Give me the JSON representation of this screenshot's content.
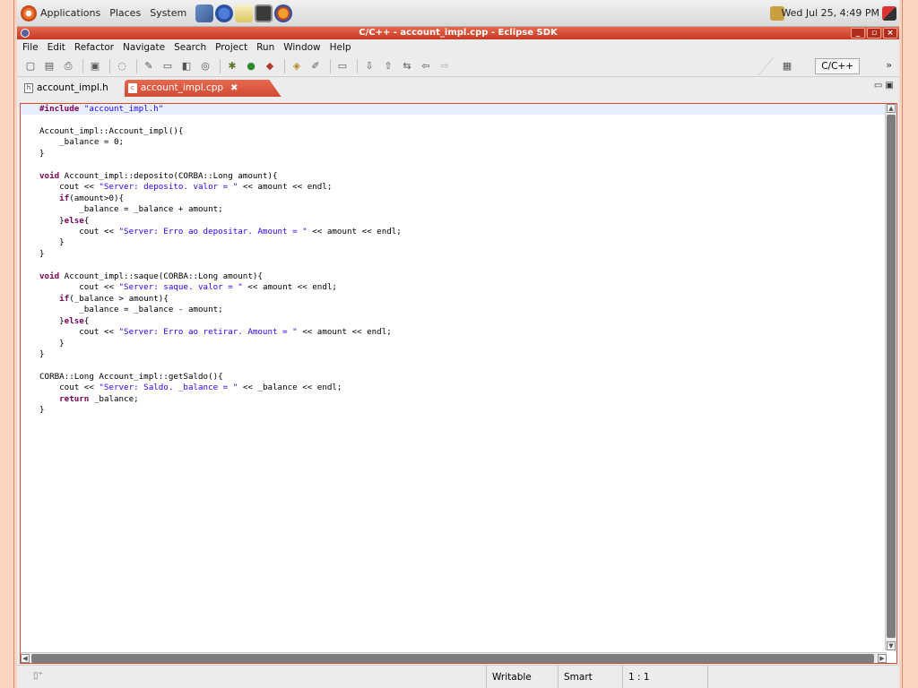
{
  "panel": {
    "menus": [
      "Applications",
      "Places",
      "System"
    ],
    "clock": "Wed Jul 25,  4:49 PM"
  },
  "window": {
    "title": "C/C++ - account_impl.cpp - Eclipse SDK",
    "controls": [
      "_",
      "▫",
      "×"
    ]
  },
  "menubar": [
    "File",
    "Edit",
    "Refactor",
    "Navigate",
    "Search",
    "Project",
    "Run",
    "Window",
    "Help"
  ],
  "toolbar": {
    "perspective": "C/C++",
    "more": "»"
  },
  "tabs": [
    {
      "label": "account_impl.h",
      "active": false
    },
    {
      "label": "account_impl.cpp",
      "active": true
    }
  ],
  "editor": {
    "lines": [
      "#include \"account_impl.h\"",
      "",
      "Account_impl::Account_impl(){",
      "    _balance = 0;",
      "}",
      "",
      "void Account_impl::deposito(CORBA::Long amount){",
      "    cout << \"Server: deposito. valor = \" << amount << endl;",
      "    if(amount>0){",
      "        _balance = _balance + amount;",
      "    }else{",
      "        cout << \"Server: Erro ao depositar. Amount = \" << amount << endl;",
      "    }",
      "}",
      "",
      "void Account_impl::saque(CORBA::Long amount){",
      "        cout << \"Server: saque. valor = \" << amount << endl;",
      "    if(_balance > amount){",
      "        _balance = _balance - amount;",
      "    }else{",
      "        cout << \"Server: Erro ao retirar. Amount = \" << amount << endl;",
      "    }",
      "}",
      "",
      "CORBA::Long Account_impl::getSaldo(){",
      "    cout << \"Server: Saldo. _balance = \" << _balance << endl;",
      "    return _balance;",
      "}"
    ]
  },
  "status": {
    "writable": "Writable",
    "insert_mode": "Smart Insert",
    "position": "1 : 1"
  },
  "colors": {
    "accent": "#d24a33",
    "keyword": "#7f0055",
    "string": "#2a00ff"
  }
}
